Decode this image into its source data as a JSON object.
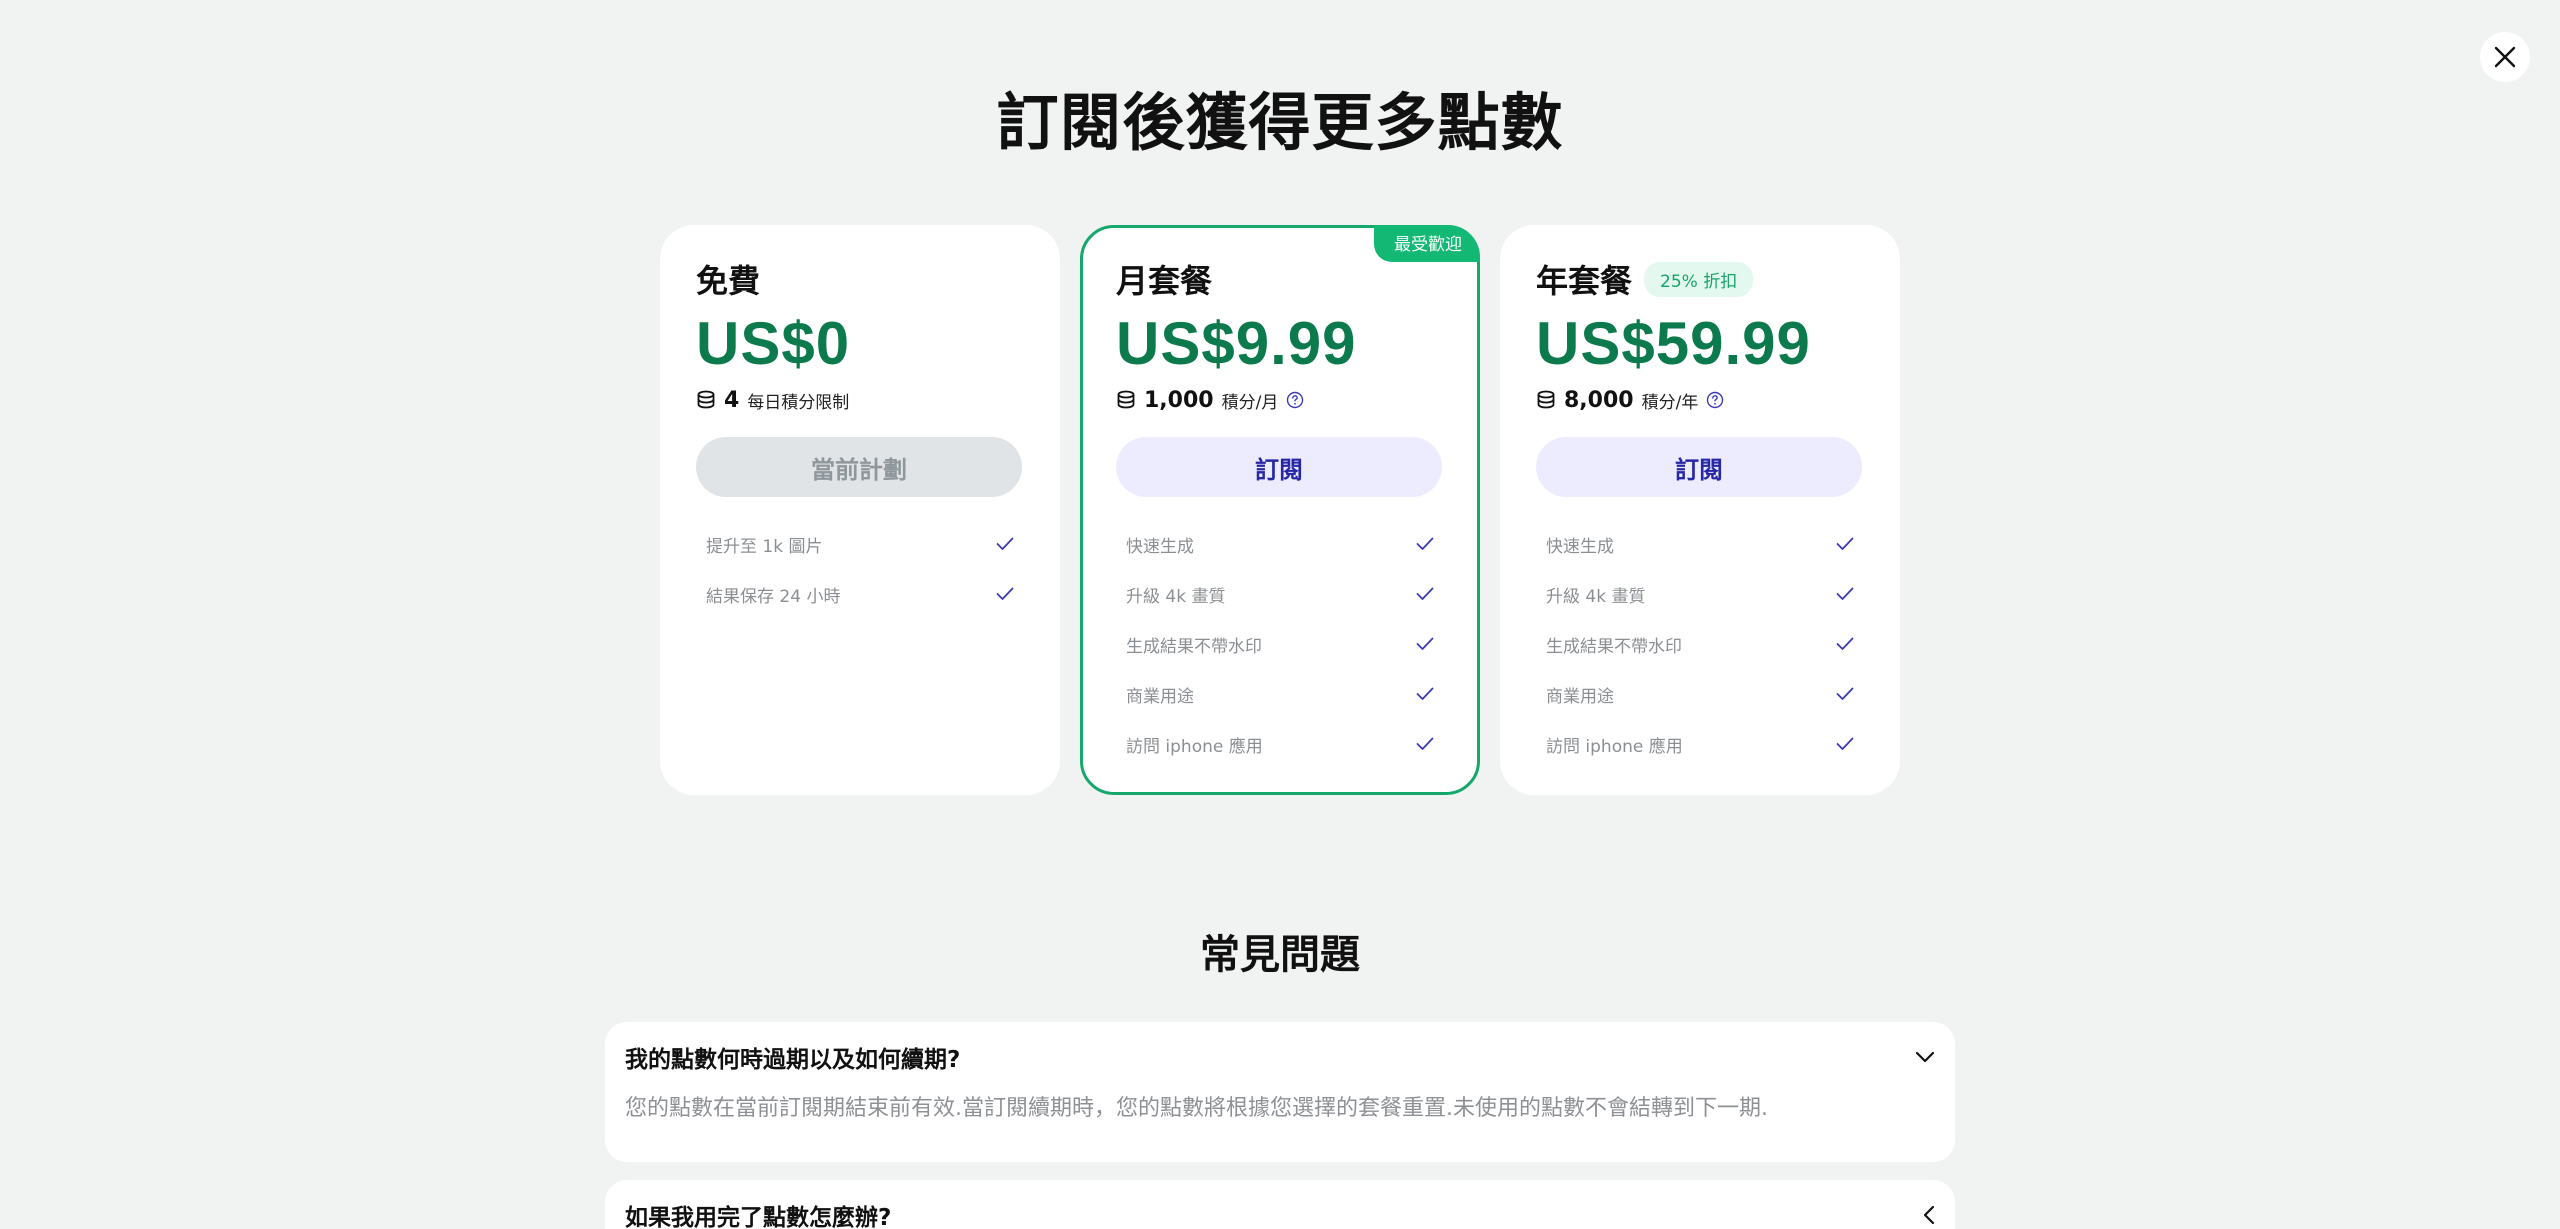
{
  "page": {
    "title": "訂閱後獲得更多點數"
  },
  "colors": {
    "accent_green": "#0c7a4c",
    "popular_badge": "#12b873",
    "subscribe_text": "#2626a6",
    "check": "#3b3bb5"
  },
  "plans": [
    {
      "name": "免費",
      "price": "US$0",
      "credits": "4",
      "credits_unit": "每日積分限制",
      "button": "當前計劃",
      "features": [
        "提升至 1k 圖片",
        "結果保存 24 小時"
      ]
    },
    {
      "name": "月套餐",
      "badge": "最受歡迎",
      "price": "US$9.99",
      "credits": "1,000",
      "credits_unit": "積分/月",
      "button": "訂閱",
      "features": [
        "快速生成",
        "升級 4k 畫質",
        "生成結果不帶水印",
        "商業用途",
        "訪問 iphone 應用"
      ]
    },
    {
      "name": "年套餐",
      "discount": "25% 折扣",
      "price": "US$59.99",
      "credits": "8,000",
      "credits_unit": "積分/年",
      "button": "訂閱",
      "features": [
        "快速生成",
        "升級 4k 畫質",
        "生成結果不帶水印",
        "商業用途",
        "訪問 iphone 應用"
      ]
    }
  ],
  "faq": {
    "title": "常見問題",
    "items": [
      {
        "question": "我的點數何時過期以及如何續期?",
        "answer": "您的點數在當前訂閱期結束前有效.當訂閱續期時，您的點數將根據您選擇的套餐重置.未使用的點數不會結轉到下一期."
      },
      {
        "question": "如果我用完了點數怎麼辦?"
      }
    ]
  },
  "icons": {
    "close": "close-icon",
    "credits": "coin-stack-icon",
    "help": "question-circle-icon",
    "check": "check-icon",
    "expand": "chevron-down-icon",
    "collapsed": "chevron-left-icon"
  }
}
